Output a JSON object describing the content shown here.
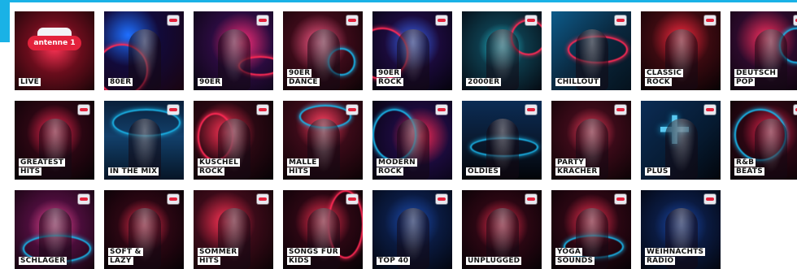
{
  "brand_logo_text": "antenne 1",
  "tiles": [
    {
      "label": [
        "LIVE"
      ]
    },
    {
      "label": [
        "80ER"
      ]
    },
    {
      "label": [
        "90ER"
      ]
    },
    {
      "label": [
        "90ER",
        "DANCE"
      ]
    },
    {
      "label": [
        "90ER",
        "ROCK"
      ]
    },
    {
      "label": [
        "2000ER"
      ]
    },
    {
      "label": [
        "CHILLOUT"
      ]
    },
    {
      "label": [
        "CLASSIC",
        "ROCK"
      ]
    },
    {
      "label": [
        "DEUTSCH",
        "POP"
      ]
    },
    {
      "label": [
        "GREATEST",
        "HITS"
      ]
    },
    {
      "label": [
        "IN THE MIX"
      ]
    },
    {
      "label": [
        "KUSCHEL",
        "ROCK"
      ]
    },
    {
      "label": [
        "MALLE",
        "HITS"
      ]
    },
    {
      "label": [
        "MODERN",
        "ROCK"
      ]
    },
    {
      "label": [
        "OLDIES"
      ]
    },
    {
      "label": [
        "PARTY",
        "KRACHER"
      ]
    },
    {
      "label": [
        "PLUS"
      ]
    },
    {
      "label": [
        "R&B",
        "BEATS"
      ]
    },
    {
      "label": [
        "SCHLAGER"
      ]
    },
    {
      "label": [
        "SOFT &",
        "LAZY"
      ]
    },
    {
      "label": [
        "SOMMER",
        "HITS"
      ]
    },
    {
      "label": [
        "SONGS FÜR",
        "KIDS"
      ]
    },
    {
      "label": [
        "TOP 40"
      ]
    },
    {
      "label": [
        "UNPLUGGED"
      ]
    },
    {
      "label": [
        "YOGA",
        "SOUNDS"
      ]
    },
    {
      "label": [
        "WEIHNACHTS",
        "RADIO"
      ]
    }
  ],
  "colors": {
    "accent": "#1ab2e6",
    "brand_red": "#e3223c",
    "tile_dark": "#0a0a12"
  }
}
